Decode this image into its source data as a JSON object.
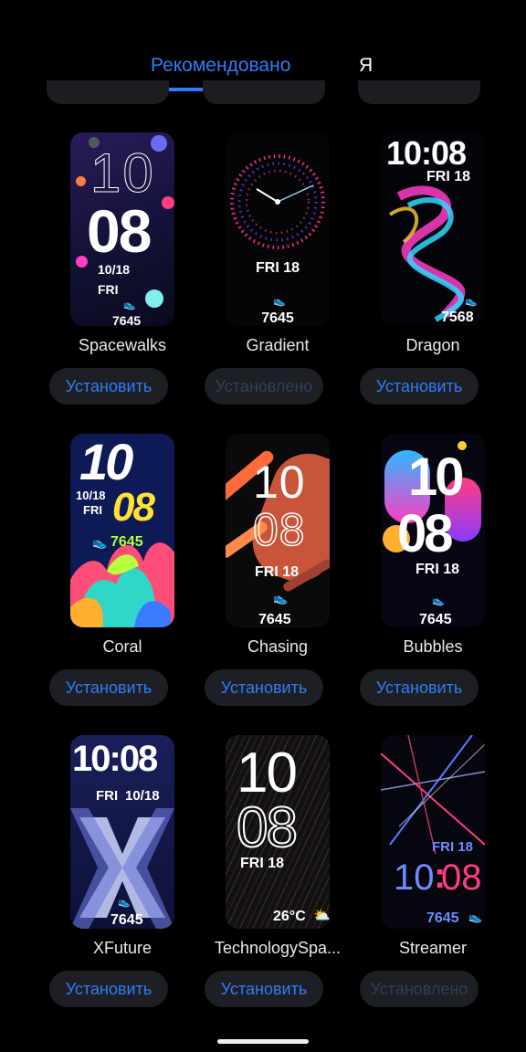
{
  "tabs": {
    "recommended": "Рекомендовано",
    "me": "Я"
  },
  "faces": [
    {
      "name": "Spacewalks",
      "button": "Установить",
      "installed": false,
      "hour": "10",
      "minute": "08",
      "date": "10/18",
      "day": "FRI",
      "steps": "7645"
    },
    {
      "name": "Gradient",
      "button": "Установлено",
      "installed": true,
      "day_date": "FRI 18",
      "steps": "7645"
    },
    {
      "name": "Dragon",
      "button": "Установить",
      "installed": false,
      "time": "10:08",
      "day_date": "FRI 18",
      "steps": "7568"
    },
    {
      "name": "Coral",
      "button": "Установить",
      "installed": false,
      "hour": "10",
      "minute": "08",
      "date": "10/18",
      "day": "FRI",
      "steps": "7645"
    },
    {
      "name": "Chasing",
      "button": "Установить",
      "installed": false,
      "hour": "10",
      "minute": "08",
      "day_date": "FRI 18",
      "steps": "7645"
    },
    {
      "name": "Bubbles",
      "button": "Установить",
      "installed": false,
      "hour": "10",
      "minute": "08",
      "day_date": "FRI 18",
      "steps": "7645"
    },
    {
      "name": "XFuture",
      "button": "Установить",
      "installed": false,
      "time": "10:08",
      "day": "FRI",
      "date": "10/18",
      "steps": "7645"
    },
    {
      "name": "TechnologySpa...",
      "button": "Установить",
      "installed": false,
      "hour": "10",
      "minute": "08",
      "day_date": "FRI 18",
      "weather": "26°C"
    },
    {
      "name": "Streamer",
      "button": "Установлено",
      "installed": true,
      "day_date": "FRI 18",
      "hour": "10",
      "minute": "08",
      "steps": "7645"
    }
  ]
}
